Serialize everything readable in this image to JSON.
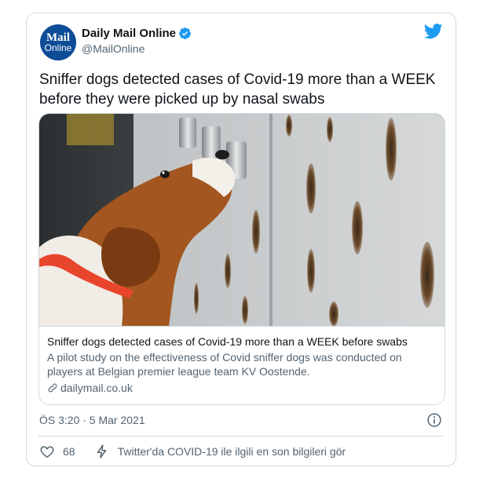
{
  "author": {
    "display_name": "Daily Mail Online",
    "handle": "@MailOnline",
    "avatar_line1": "Mail",
    "avatar_line2": "Online",
    "verified_icon": "verified-badge-icon",
    "brand_color": "#1d9bf0"
  },
  "tweet": {
    "text": "Sniffer dogs detected cases of Covid-19 more than a WEEK before they were picked up by nasal swabs"
  },
  "card": {
    "image_alt_icon": "beagle-sniffing-wall-photo",
    "title": "Sniffer dogs detected cases of Covid-19 more than a WEEK before swabs",
    "description": "A pilot study on the effectiveness of Covid sniffer dogs was conducted on players at Belgian premier league team KV Oostende.",
    "domain": "dailymail.co.uk"
  },
  "meta": {
    "timestamp": "ÖS 3:20 · 5 Mar 2021"
  },
  "actions": {
    "like_count": "68",
    "covid_link": "Twitter'da COVID-19 ile ilgili en son bilgileri gör"
  },
  "colors": {
    "text_primary": "#0f1419",
    "text_secondary": "#536471",
    "border": "#cfd9de",
    "avatar_bg": "#0d4c96"
  }
}
